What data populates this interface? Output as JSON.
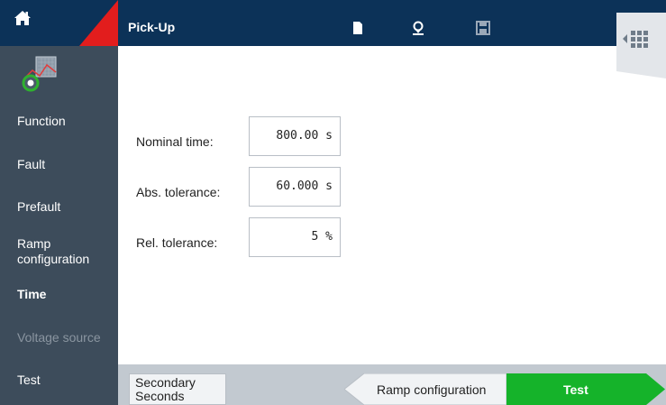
{
  "header": {
    "title": "Pick-Up",
    "icons": [
      "home-icon",
      "file-icon",
      "location-icon",
      "save-icon",
      "grid-icon"
    ]
  },
  "sidebar": {
    "function_icon": "ramp-function-icon",
    "items": [
      {
        "label": "Function",
        "state": "normal"
      },
      {
        "label": "Fault",
        "state": "normal"
      },
      {
        "label": "Prefault",
        "state": "normal"
      },
      {
        "label": "Ramp\nconfiguration",
        "state": "normal"
      },
      {
        "label": "Time",
        "state": "active"
      },
      {
        "label": "Voltage source",
        "state": "disabled"
      },
      {
        "label": "Test",
        "state": "normal"
      }
    ]
  },
  "form": {
    "fields": [
      {
        "label": "Nominal time:",
        "value": "800.00 s"
      },
      {
        "label": "Abs. tolerance:",
        "value": "60.000 s"
      },
      {
        "label": "Rel. tolerance:",
        "value": "5 %"
      }
    ]
  },
  "footer": {
    "secondary_label_line1": "Secondary",
    "secondary_label_line2": "Seconds",
    "prev_label": "Ramp configuration",
    "next_label": "Test"
  },
  "colors": {
    "header": "#0c3258",
    "sidebar": "#3d4c5b",
    "accent_red": "#e21d1d",
    "next_green": "#15b32a",
    "bottom_bar": "#c2c9d0"
  }
}
